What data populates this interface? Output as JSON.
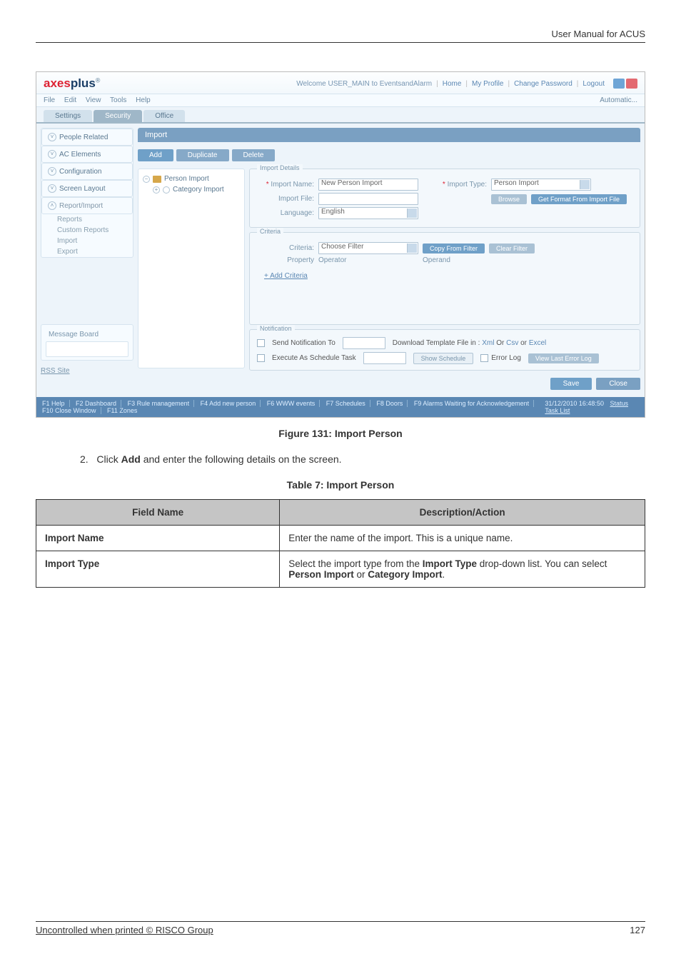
{
  "doc": {
    "header": "User Manual for ACUS",
    "figure_caption": "Figure 131: Import Person",
    "step_prefix": "2.",
    "step_action": "Click ",
    "step_bold": "Add",
    "step_rest": " and enter the following details on the screen.",
    "table_caption": "Table 7: Import Person",
    "table": {
      "col1": "Field Name",
      "col2": "Description/Action",
      "rows": [
        {
          "name": "Import Name",
          "desc_parts": [
            "Enter the name of the import. This is a unique name."
          ]
        },
        {
          "name": "Import Type",
          "desc_parts": [
            "Select the import type from the ",
            "Import Type",
            " drop-down list. You can select ",
            "Person Import",
            " or ",
            "Category Import",
            "."
          ]
        }
      ]
    },
    "footer_left": "Uncontrolled when printed © RISCO Group",
    "footer_right": "127"
  },
  "app": {
    "logo_prefix": "axes",
    "logo_suffix": "plus",
    "welcome": "Welcome USER_MAIN to EventsandAlarm",
    "nav_home": "Home",
    "nav_profile": "My Profile",
    "nav_change_pw": "Change Password",
    "nav_logout": "Logout",
    "menu": {
      "file": "File",
      "edit": "Edit",
      "view": "View",
      "tools": "Tools",
      "help": "Help"
    },
    "automatic": "Automatic...",
    "tabs": {
      "settings": "Settings",
      "security": "Security",
      "office": "Office"
    },
    "sidebar": {
      "people": "People Related",
      "ac": "AC Elements",
      "config": "Configuration",
      "screen": "Screen Layout",
      "report": "Report/Import",
      "sub_reports": "Reports",
      "sub_custom": "Custom Reports",
      "sub_import": "Import",
      "sub_export": "Export",
      "msgboard": "Message Board",
      "rss": "RSS Site"
    },
    "panel_title": "Import",
    "toolbar": {
      "add": "Add",
      "duplicate": "Duplicate",
      "delete": "Delete"
    },
    "tree": {
      "person": "Person Import",
      "category": "Category Import"
    },
    "form": {
      "fs_import": "Import Details",
      "import_name_lbl": "Import Name:",
      "import_name_val": "New Person Import",
      "import_type_lbl": "Import Type:",
      "import_type_val": "Person Import",
      "import_file_lbl": "Import File:",
      "browse_btn": "Browse",
      "get_format_btn": "Get Format From Import File",
      "language_lbl": "Language:",
      "language_val": "English",
      "fs_criteria": "Criteria",
      "criteria_lbl": "Criteria:",
      "choose_filter": "Choose Filter",
      "copy_filter_btn": "Copy From Filter",
      "clear_filter_btn": "Clear Filter",
      "property_lbl": "Property",
      "operator_lbl": "Operator",
      "operand_lbl": "Operand",
      "add_criteria": "+ Add Criteria",
      "fs_notif": "Notification",
      "send_notif": "Send Notification To",
      "exec_sched": "Execute As Schedule Task",
      "dl_template": "Download Template File in :",
      "dl_xml": "Xml",
      "dl_or1": "Or",
      "dl_csv": "Csv",
      "dl_or2": "or",
      "dl_excel": "Excel",
      "show_sched": "Show Schedule",
      "error_log": "Error Log",
      "view_last": "View Last Error Log",
      "save": "Save",
      "close": "Close"
    },
    "fkeys": {
      "f1": "F1 Help",
      "f2": "F2 Dashboard",
      "f3": "F3 Rule management",
      "f4": "F4 Add new person",
      "f6": "F6 WWW events",
      "f7": "F7 Schedules",
      "f8": "F8 Doors",
      "f9": "F9 Alarms Waiting for Acknowledgement",
      "f10": "F10 Close Window",
      "f11": "F11 Zones",
      "time": "31/12/2010 16:48:50",
      "status": "Status",
      "tasklist": "Task List"
    }
  }
}
